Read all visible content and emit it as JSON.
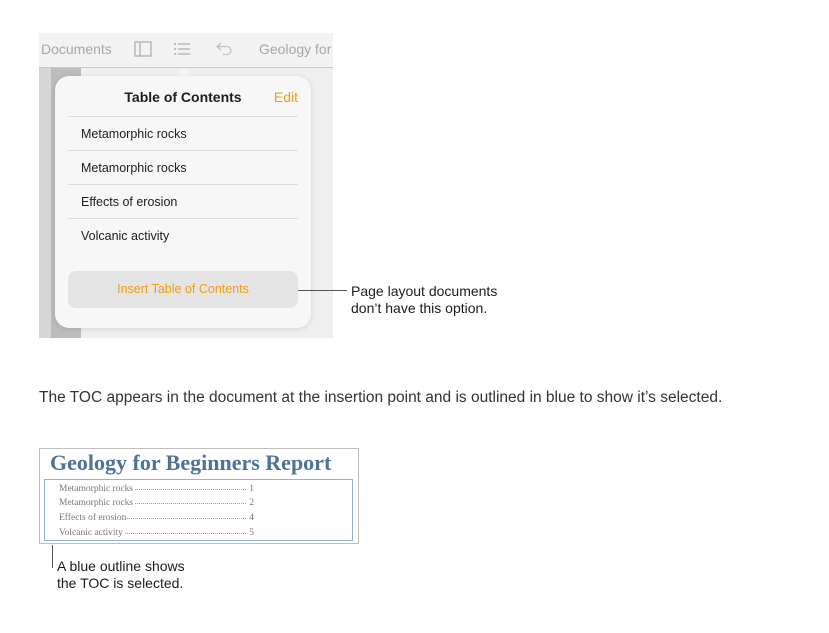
{
  "toolbar": {
    "documents_label": "Documents",
    "doc_title": "Geology for"
  },
  "toc_popover": {
    "title": "Table of Contents",
    "edit_label": "Edit",
    "items": [
      {
        "label": "Metamorphic rocks"
      },
      {
        "label": "Metamorphic rocks"
      },
      {
        "label": "Effects of erosion"
      },
      {
        "label": "Volcanic activity"
      }
    ],
    "insert_button_label": "Insert Table of Contents"
  },
  "callout_insert": {
    "line1": "Page layout documents",
    "line2": "don’t have this option."
  },
  "caption": "The TOC appears in the document at the insertion point and is outlined in blue to show it’s selected.",
  "document": {
    "heading": "Geology for Beginners Report",
    "toc_entries": [
      {
        "label": "Metamorphic rocks",
        "page": "1"
      },
      {
        "label": "Metamorphic rocks",
        "page": "2"
      },
      {
        "label": "Effects of erosion",
        "page": "4"
      },
      {
        "label": "Volcanic activity",
        "page": "5"
      }
    ]
  },
  "callout_outline": {
    "line1": "A blue outline shows",
    "line2": "the TOC is selected."
  },
  "colors": {
    "accent": "#f39c12",
    "outline_blue": "#8fb2d8",
    "heading_blue": "#4f7297"
  }
}
